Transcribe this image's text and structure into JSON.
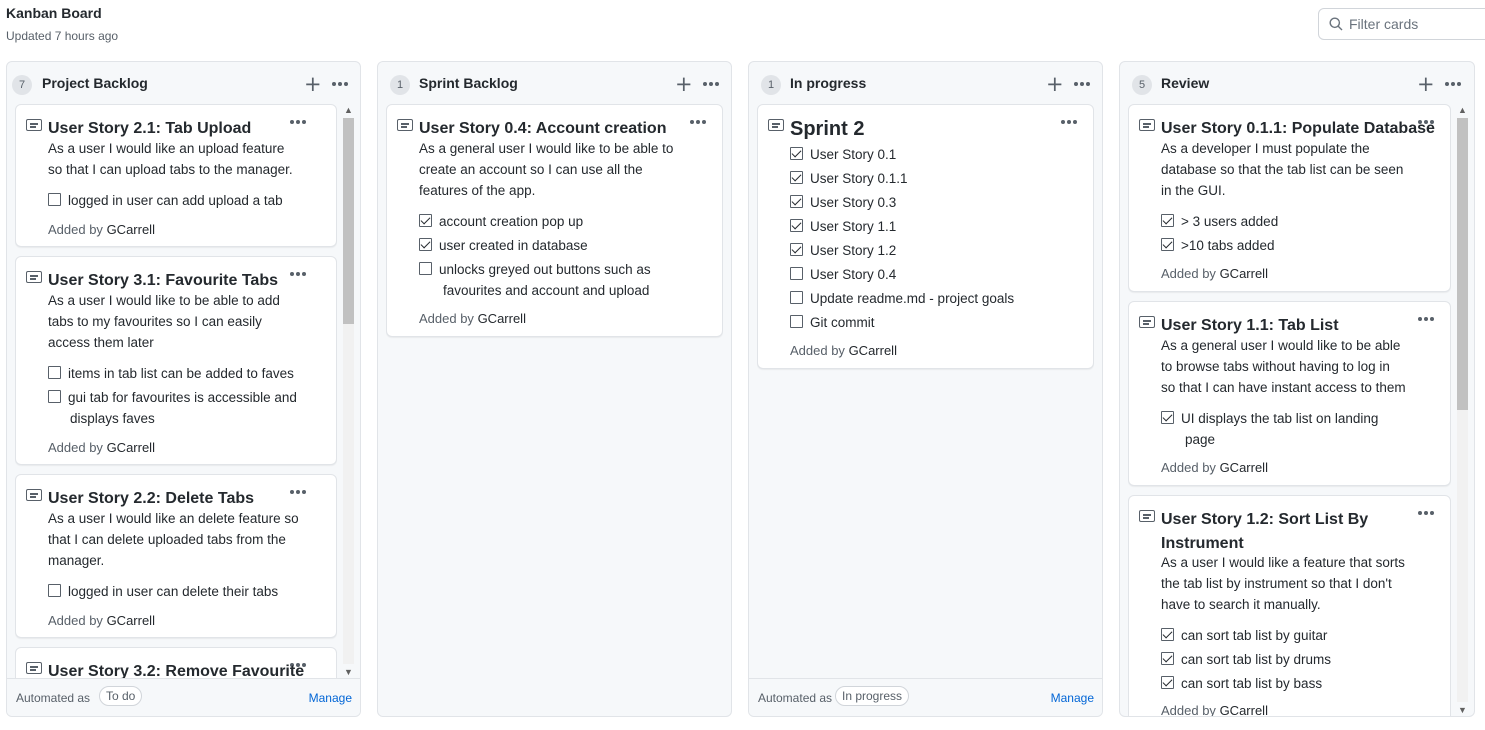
{
  "header": {
    "title": "Kanban Board",
    "updated": "Updated 7 hours ago",
    "filter_placeholder": "Filter cards"
  },
  "columns": [
    {
      "count": "7",
      "name": "Project Backlog",
      "automated_label": "Automated as",
      "automation": "To do",
      "manage": "Manage",
      "cards": [
        {
          "title": "User Story 2.1: Tab Upload",
          "body": [
            "As a user I would like an upload feature",
            "so that I can upload tabs to the manager."
          ],
          "checks": [
            {
              "text": "logged in user can add upload a tab",
              "checked": false
            }
          ],
          "added_by_label": "Added by",
          "added_by": "GCarrell"
        },
        {
          "title": "User Story 3.1: Favourite Tabs",
          "body": [
            "As a user I would like to be able to add",
            "tabs to my favourites so I can easily",
            "access them later"
          ],
          "checks": [
            {
              "text": "items in tab list can be added to faves",
              "checked": false
            },
            {
              "text": "gui tab for favourites is accessible and",
              "text2": "displays faves",
              "checked": false
            }
          ],
          "added_by_label": "Added by",
          "added_by": "GCarrell"
        },
        {
          "title": "User Story 2.2: Delete Tabs",
          "body": [
            "As a user I would like an delete feature so",
            "that I can delete uploaded tabs from the",
            "manager."
          ],
          "checks": [
            {
              "text": "logged in user can delete their tabs",
              "checked": false
            }
          ],
          "added_by_label": "Added by",
          "added_by": "GCarrell"
        },
        {
          "title": "User Story 3.2: Remove Favourite"
        }
      ]
    },
    {
      "count": "1",
      "name": "Sprint Backlog",
      "cards": [
        {
          "title": "User Story 0.4: Account creation",
          "body": [
            "As a general user I would like to be able to",
            "create an account so I can use all the",
            "features of the app."
          ],
          "checks": [
            {
              "text": "account creation pop up",
              "checked": true
            },
            {
              "text": "user created in database",
              "checked": true
            },
            {
              "text": "unlocks greyed out buttons such as",
              "text2": "favourites and account and upload",
              "checked": false
            }
          ],
          "added_by_label": "Added by",
          "added_by": "GCarrell"
        }
      ]
    },
    {
      "count": "1",
      "name": "In progress",
      "automated_label": "Automated as",
      "automation": "In progress",
      "manage": "Manage",
      "cards": [
        {
          "title": "Sprint 2",
          "checks": [
            {
              "text": "User Story 0.1",
              "checked": true
            },
            {
              "text": "User Story 0.1.1",
              "checked": true
            },
            {
              "text": "User Story 0.3",
              "checked": true
            },
            {
              "text": "User Story 1.1",
              "checked": true
            },
            {
              "text": "User Story 1.2",
              "checked": true
            },
            {
              "text": "User Story 0.4",
              "checked": false
            },
            {
              "text": "Update readme.md - project goals",
              "checked": false
            },
            {
              "text": "Git commit",
              "checked": false
            }
          ],
          "added_by_label": "Added by",
          "added_by": "GCarrell"
        }
      ]
    },
    {
      "count": "5",
      "name": "Review",
      "cards": [
        {
          "title": "User Story 0.1.1: Populate Database",
          "body": [
            "As a developer I must populate the",
            "database so that the tab list can be seen",
            "in the GUI."
          ],
          "checks": [
            {
              "text": "> 3 users added",
              "checked": true
            },
            {
              "text": ">10 tabs added",
              "checked": true
            }
          ],
          "added_by_label": "Added by",
          "added_by": "GCarrell"
        },
        {
          "title": "User Story 1.1: Tab List",
          "body": [
            "As a general user I would like to be able",
            "to browse tabs without having to log in",
            "so that I can have instant access to them"
          ],
          "checks": [
            {
              "text": "UI displays the tab list on landing",
              "text2": "page",
              "checked": true
            }
          ],
          "added_by_label": "Added by",
          "added_by": "GCarrell"
        },
        {
          "title": "User Story 1.2: Sort List By",
          "title2": "Instrument",
          "body": [
            "As a user I would like a feature that sorts",
            "the tab list by instrument so that I don't",
            "have to search it manually."
          ],
          "checks": [
            {
              "text": "can sort tab list by guitar",
              "checked": true
            },
            {
              "text": "can sort tab list by drums",
              "checked": true
            },
            {
              "text": "can sort tab list by bass",
              "checked": true
            }
          ],
          "added_by_label": "Added by",
          "added_by": "GCarrell"
        }
      ]
    }
  ],
  "icons": {
    "search": "search-icon",
    "add": "plus-icon",
    "more": "kebab-horizontal-icon",
    "note": "note-icon",
    "checkbox": "checkbox-icon"
  },
  "colors": {
    "link": "#0366d6",
    "column_bg": "#f6f8fa",
    "border": "#e1e4e8"
  }
}
